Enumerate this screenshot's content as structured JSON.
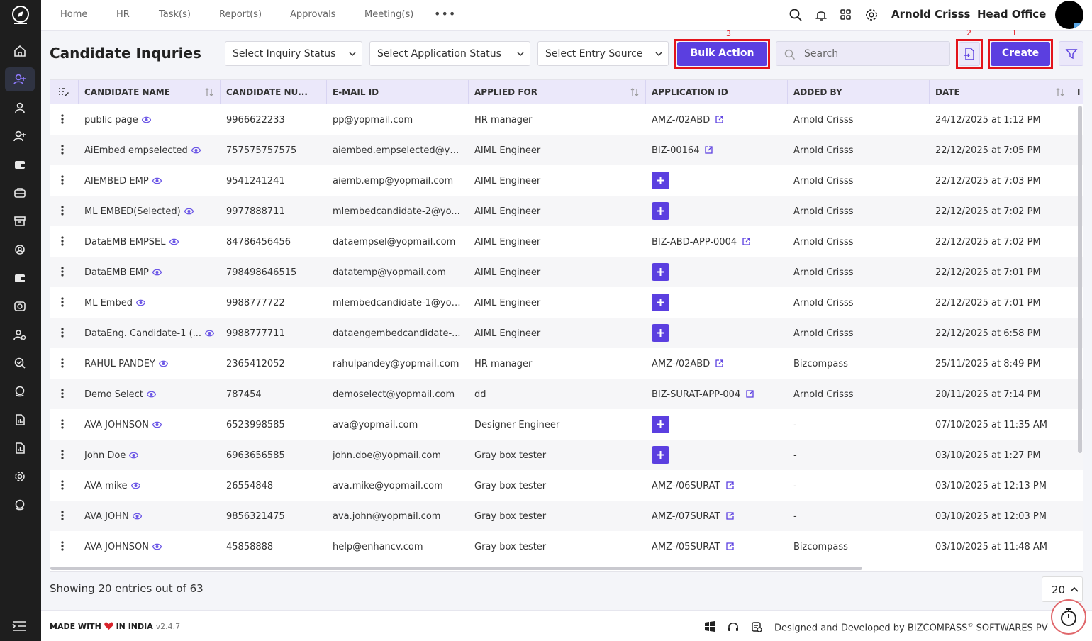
{
  "nav": {
    "items": [
      "Home",
      "HR",
      "Task(s)",
      "Report(s)",
      "Approvals",
      "Meeting(s)"
    ],
    "more_icon": "more-dots-icon"
  },
  "topbar": {
    "user_name": "Arnold Crisss",
    "office": "Head Office"
  },
  "page": {
    "title": "Candidate Inquries"
  },
  "filters": {
    "inquiry_status": "Select Inquiry Status",
    "application_status": "Select Application Status",
    "entry_source": "Select Entry Source"
  },
  "actions": {
    "bulk_action": "Bulk Action",
    "bulk_action_marker": "3",
    "export_marker": "2",
    "create": "Create",
    "create_marker": "1",
    "search_placeholder": "Search"
  },
  "table": {
    "columns": [
      "CANDIDATE NAME",
      "CANDIDATE NU...",
      "E-MAIL ID",
      "APPLIED FOR",
      "APPLICATION ID",
      "ADDED BY",
      "DATE"
    ],
    "rows": [
      {
        "name": "public page",
        "number": "9966622233",
        "email": "pp@yopmail.com",
        "applied_for": "HR manager",
        "app_id": "AMZ-/02ABD",
        "added_by": "Arnold Crisss",
        "date": "24/12/2025 at 1:12 PM"
      },
      {
        "name": "AiEmbed empselected",
        "number": "757575757575",
        "email": "aiembed.empselected@yo...",
        "applied_for": "AIML Engineer",
        "app_id": "BIZ-00164",
        "added_by": "Arnold Crisss",
        "date": "22/12/2025 at 7:05 PM"
      },
      {
        "name": "AIEMBED EMP",
        "number": "9541241241",
        "email": "aiemb.emp@yopmail.com",
        "applied_for": "AIML Engineer",
        "app_id": "",
        "added_by": "Arnold Crisss",
        "date": "22/12/2025 at 7:03 PM"
      },
      {
        "name": "ML EMBED(Selected)",
        "number": "9977888711",
        "email": "mlembedcandidate-2@yo...",
        "applied_for": "AIML Engineer",
        "app_id": "",
        "added_by": "Arnold Crisss",
        "date": "22/12/2025 at 7:02 PM"
      },
      {
        "name": "DataEMB EMPSEL",
        "number": "84786456456",
        "email": "dataempsel@yopmail.com",
        "applied_for": "AIML Engineer",
        "app_id": "BIZ-ABD-APP-0004",
        "added_by": "Arnold Crisss",
        "date": "22/12/2025 at 7:02 PM"
      },
      {
        "name": "DataEMB EMP",
        "number": "798498646515",
        "email": "datatemp@yopmail.com",
        "applied_for": "AIML Engineer",
        "app_id": "",
        "added_by": "Arnold Crisss",
        "date": "22/12/2025 at 7:01 PM"
      },
      {
        "name": "ML Embed",
        "number": "9988777722",
        "email": "mlembedcandidate-1@yop...",
        "applied_for": "AIML Engineer",
        "app_id": "",
        "added_by": "Arnold Crisss",
        "date": "22/12/2025 at 7:01 PM"
      },
      {
        "name": "DataEng. Candidate-1 (...",
        "number": "9988777711",
        "email": "dataengembedcandidate-...",
        "applied_for": "AIML Engineer",
        "app_id": "",
        "added_by": "Arnold Crisss",
        "date": "22/12/2025 at 6:58 PM"
      },
      {
        "name": "RAHUL PANDEY",
        "number": "2365412052",
        "email": "rahulpandey@yopmail.com",
        "applied_for": "HR manager",
        "app_id": "AMZ-/02ABD",
        "added_by": "Bizcompass",
        "date": "25/11/2025 at 8:49 PM"
      },
      {
        "name": "Demo Select",
        "number": "787454",
        "email": "demoselect@yopmail.com",
        "applied_for": "dd",
        "app_id": "BIZ-SURAT-APP-004",
        "added_by": "Arnold Crisss",
        "date": "20/11/2025 at 7:14 PM"
      },
      {
        "name": "AVA JOHNSON",
        "number": "6523998585",
        "email": "ava@yopmail.com",
        "applied_for": "Designer Engineer",
        "app_id": "",
        "added_by": "-",
        "date": "07/10/2025 at 11:35 AM"
      },
      {
        "name": "John Doe",
        "number": "6963656585",
        "email": "john.doe@yopmail.com",
        "applied_for": "Gray box tester",
        "app_id": "",
        "added_by": "-",
        "date": "03/10/2025 at 1:27 PM"
      },
      {
        "name": "AVA mike",
        "number": "26554848",
        "email": "ava.mike@yopmail.com",
        "applied_for": "Gray box tester",
        "app_id": "AMZ-/06SURAT",
        "added_by": "-",
        "date": "03/10/2025 at 12:13 PM"
      },
      {
        "name": "AVA JOHN",
        "number": "9856321475",
        "email": "ava.john@yopmail.com",
        "applied_for": "Gray box tester",
        "app_id": "AMZ-/07SURAT",
        "added_by": "-",
        "date": "03/10/2025 at 12:03 PM"
      },
      {
        "name": "AVA JOHNSON",
        "number": "45858888",
        "email": "help@enhancv.com",
        "applied_for": "Gray box tester",
        "app_id": "AMZ-/05SURAT",
        "added_by": "Bizcompass",
        "date": "03/10/2025 at 11:48 AM"
      }
    ]
  },
  "pagination": {
    "showing_text": "Showing 20 entries out of 63",
    "page_size": "20"
  },
  "footer": {
    "made_prefix": "MADE WITH",
    "made_suffix": "IN INDIA",
    "version": "v2.4.7",
    "designed_prefix": "Designed and Developed by",
    "company": "BIZCOMPASS",
    "reg": "®",
    "company_suffix": "SOFTWARES PV"
  },
  "colors": {
    "accent": "#5b3fe0",
    "highlight": "#e3141b",
    "sidebar": "#1e1e1e",
    "header_bg": "#ebe8fa"
  }
}
